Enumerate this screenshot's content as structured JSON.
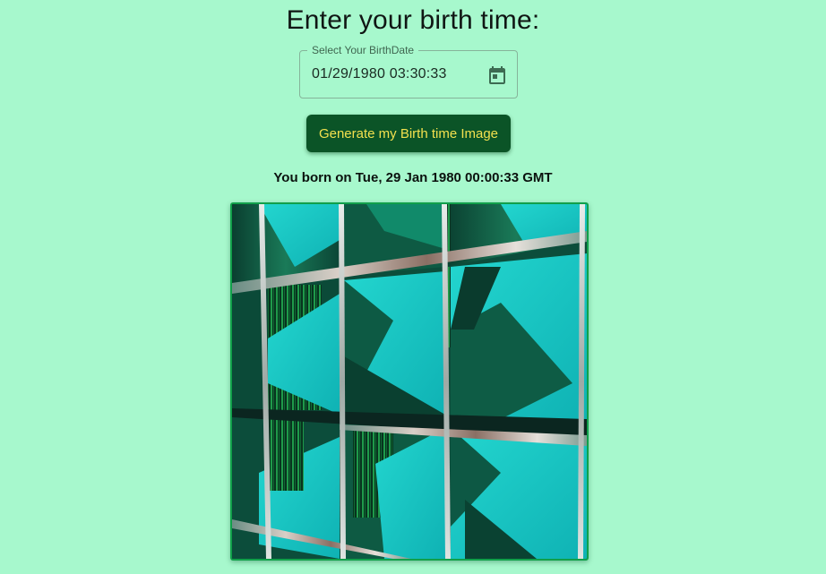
{
  "page": {
    "heading": "Enter your birth time:"
  },
  "date_field": {
    "label": "Select Your BirthDate",
    "value": "01/29/1980 03:30:33",
    "icon": "calendar-icon"
  },
  "actions": {
    "generate_label": "Generate my Birth time Image"
  },
  "result": {
    "born_text": "You born on Tue, 29 Jan 1980 00:00:33 GMT"
  },
  "colors": {
    "background": "#a7f8cd",
    "button_bg": "#0b5427",
    "button_text": "#f2e04e",
    "frame_border": "#11a04a",
    "art_cyan": "#12c9c4",
    "art_dark_green": "#0d5c42"
  }
}
